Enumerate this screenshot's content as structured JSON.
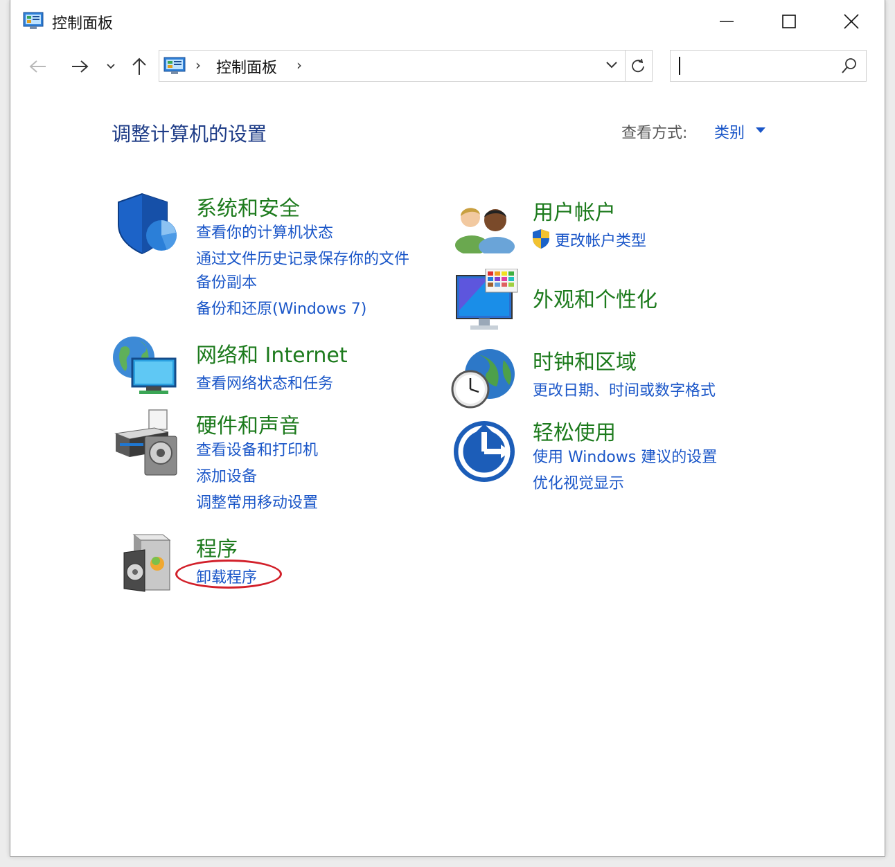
{
  "window": {
    "title": "控制面板"
  },
  "address": {
    "path": "控制面板",
    "separator": "›"
  },
  "search": {
    "value": ""
  },
  "header": {
    "title": "调整计算机的设置",
    "view_label": "查看方式:",
    "view_value": "类别"
  },
  "categories": {
    "system": {
      "title": "系统和安全",
      "links": [
        "查看你的计算机状态",
        "通过文件历史记录保存你的文件",
        "备份副本",
        "备份和还原(Windows 7)"
      ]
    },
    "network": {
      "title": "网络和 Internet",
      "links": [
        "查看网络状态和任务"
      ]
    },
    "hardware": {
      "title": "硬件和声音",
      "links": [
        "查看设备和打印机",
        "添加设备",
        "调整常用移动设置"
      ]
    },
    "programs": {
      "title": "程序",
      "links": [
        "卸载程序"
      ]
    },
    "users": {
      "title": "用户帐户",
      "links": [
        "更改帐户类型"
      ]
    },
    "appearance": {
      "title": "外观和个性化",
      "links": []
    },
    "clock": {
      "title": "时钟和区域",
      "links": [
        "更改日期、时间或数字格式"
      ]
    },
    "ease": {
      "title": "轻松使用",
      "links": [
        "使用 Windows 建议的设置",
        "优化视觉显示"
      ]
    }
  },
  "colors": {
    "category_title": "#1c7a1c",
    "link": "#1a56c8",
    "page_title": "#1e3c87",
    "highlight": "#d2202a"
  },
  "icons": {
    "system": "shield-icon",
    "network": "network-icon",
    "hardware": "printer-icon",
    "programs": "programs-icon",
    "users": "users-icon",
    "appearance": "monitor-palette-icon",
    "clock": "globe-clock-icon",
    "ease": "ease-of-access-icon"
  }
}
